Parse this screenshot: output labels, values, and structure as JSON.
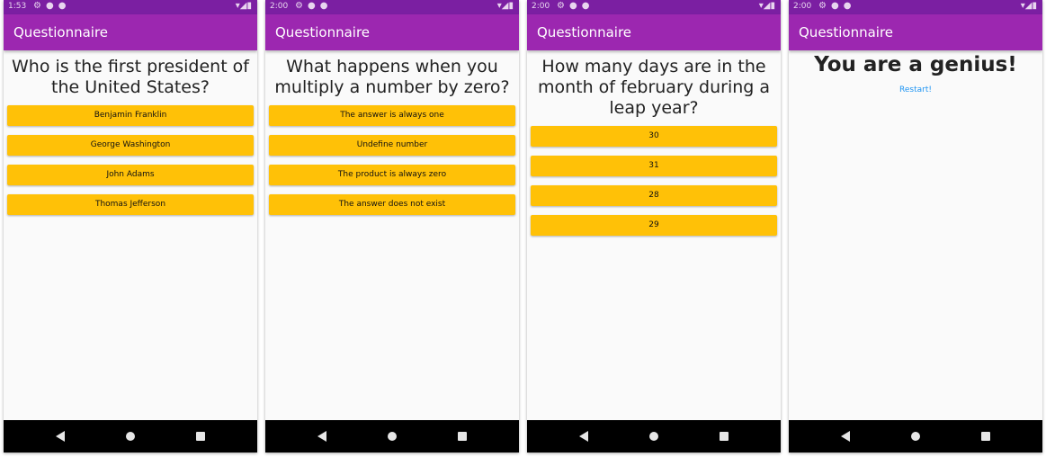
{
  "app_title": "Questionnaire",
  "screens": [
    {
      "time": "1:53",
      "question": "Who is the first president of the United States?",
      "answers": [
        "Benjamin Franklin",
        "George Washington",
        "John Adams",
        "Thomas Jefferson"
      ]
    },
    {
      "time": "2:00",
      "question": "What happens when you multiply a number by zero?",
      "answers": [
        "The answer is always one",
        "Undefine number",
        "The product is always zero",
        "The answer does not exist"
      ]
    },
    {
      "time": "2:00",
      "question": "How many days are in the month of february during a leap year?",
      "answers": [
        "30",
        "31",
        "28",
        "29"
      ]
    },
    {
      "time": "2:00",
      "result": "You are a genius!",
      "restart_label": "Restart!"
    }
  ],
  "status_icons": {
    "settings": "gear-icon",
    "wifi": "wifi-icon",
    "signal": "signal-icon",
    "battery": "battery-icon"
  },
  "nav_icons": {
    "back": "back-triangle-icon",
    "home": "home-circle-icon",
    "recents": "recents-square-icon"
  },
  "colors": {
    "status_bar": "#7b1fa2",
    "app_bar": "#9c27b0",
    "answer_button": "#ffc107",
    "restart_link": "#2196f3",
    "nav_bar": "#000000"
  }
}
